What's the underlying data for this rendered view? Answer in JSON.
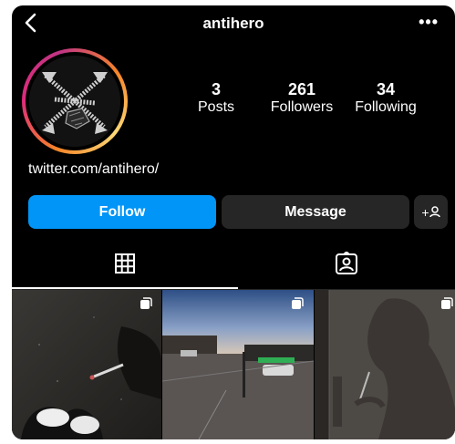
{
  "header": {
    "username": "antihero",
    "more": "•••"
  },
  "stats": [
    {
      "value": "3",
      "label": "Posts"
    },
    {
      "value": "261",
      "label": "Followers"
    },
    {
      "value": "34",
      "label": "Following"
    }
  ],
  "bio": {
    "link": "twitter.com/antihero/"
  },
  "buttons": {
    "follow": "Follow",
    "message": "Message",
    "add_user": "+"
  },
  "colors": {
    "accent": "#0095f6",
    "secondary_button": "#262626",
    "background": "#000000"
  },
  "tabs": [
    {
      "icon": "grid-icon",
      "active": true
    },
    {
      "icon": "tagged-icon",
      "active": false
    }
  ],
  "posts": [
    {
      "icon": "multiple-posts-icon"
    },
    {
      "icon": "multiple-posts-icon"
    },
    {
      "icon": "multiple-posts-icon"
    }
  ]
}
